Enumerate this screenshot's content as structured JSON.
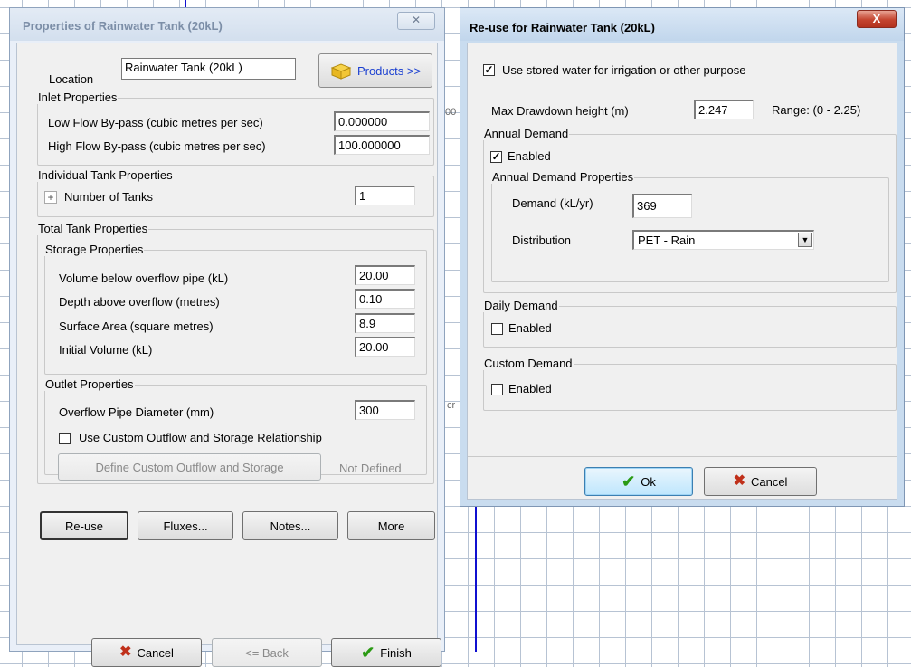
{
  "left": {
    "title": "Properties of Rainwater Tank (20kL)",
    "close_glyph": "✕",
    "location_label": "Location",
    "location_value": "Rainwater Tank (20kL)",
    "products_button": "Products >>",
    "inlet": {
      "title": "Inlet Properties",
      "low_label": "Low Flow By-pass (cubic metres per sec)",
      "low_value": "0.000000",
      "high_label": "High Flow By-pass (cubic metres per sec)",
      "high_value": "100.000000"
    },
    "individual": {
      "title": "Individual Tank Properties",
      "expand_glyph": "+",
      "tanks_label": "Number of Tanks",
      "tanks_value": "1"
    },
    "total": {
      "title": "Total Tank Properties",
      "storage_title": "Storage Properties",
      "volume_label": "Volume below overflow pipe  (kL)",
      "volume_value": "20.00",
      "depth_label": "Depth above overflow (metres)",
      "depth_value": "0.10",
      "area_label": "Surface Area (square metres)",
      "area_value": "8.9",
      "initial_label": "Initial Volume (kL)",
      "initial_value": "20.00",
      "outlet_title": "Outlet Properties",
      "pipe_label": "Overflow Pipe Diameter (mm)",
      "pipe_value": "300",
      "custom_check_label": "Use Custom Outflow and Storage Relationship",
      "define_button": "Define Custom Outflow and Storage",
      "not_defined": "Not Defined"
    },
    "buttons": {
      "reuse": "Re-use",
      "fluxes": "Fluxes...",
      "notes": "Notes...",
      "more": "More",
      "cancel": "Cancel",
      "back": "<= Back",
      "finish": "Finish"
    }
  },
  "right": {
    "title": "Re-use for Rainwater Tank (20kL)",
    "close_glyph": "X",
    "use_stored_label": "Use stored water for irrigation or other purpose",
    "use_stored_checked": true,
    "max_label": "Max Drawdown height (m)",
    "max_value": "2.247",
    "range_text": "Range: (0 - 2.25)",
    "annual": {
      "title": "Annual Demand",
      "enabled_label": "Enabled",
      "enabled_checked": true,
      "props_title": "Annual Demand Properties",
      "demand_label": "Demand (kL/yr)",
      "demand_value": "369",
      "distribution_label": "Distribution",
      "distribution_value": "PET - Rain"
    },
    "daily": {
      "title": "Daily Demand",
      "enabled_label": "Enabled",
      "enabled_checked": false
    },
    "custom": {
      "title": "Custom Demand",
      "enabled_label": "Enabled",
      "enabled_checked": false
    },
    "ok": "Ok",
    "cancel": "Cancel"
  },
  "background": {
    "text_fragment_1": "00",
    "text_fragment_2": "cr"
  },
  "colors": {
    "grid_line": "#b7c3d3",
    "canvas_blue_line": "#1010d0",
    "cancel_x": "#c0301a",
    "ok_check": "#2b9a14",
    "products_blue": "#1a3fd0"
  }
}
